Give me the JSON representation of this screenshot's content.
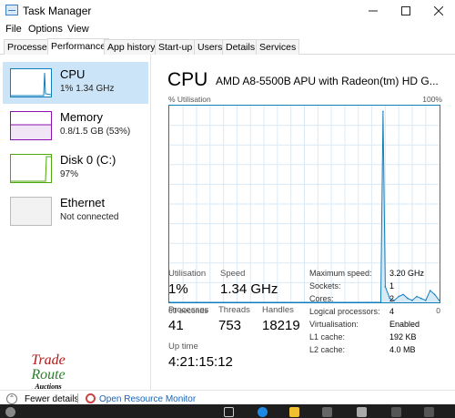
{
  "window": {
    "title": "Task Manager"
  },
  "menu": [
    "File",
    "Options",
    "View"
  ],
  "tabs": [
    "Processes",
    "Performance",
    "App history",
    "Start-up",
    "Users",
    "Details",
    "Services"
  ],
  "sidebar": [
    {
      "name": "CPU",
      "sub": "1% 1.34 GHz",
      "color": "#117dbb"
    },
    {
      "name": "Memory",
      "sub": "0.8/1.5 GB (53%)",
      "color": "#8b12ae"
    },
    {
      "name": "Disk 0 (C:)",
      "sub": "97%",
      "color": "#4da60c"
    },
    {
      "name": "Ethernet",
      "sub": "Not connected",
      "color": "#bbbbbb"
    }
  ],
  "main": {
    "title": "CPU",
    "model": "AMD A8-5500B APU with Radeon(tm) HD G...",
    "graph_label": "% Utilisation",
    "graph_max": "100%",
    "axis_left": "60 seconds",
    "axis_right": "0"
  },
  "stats": {
    "utilisation": {
      "label": "Utilisation",
      "value": "1%"
    },
    "speed": {
      "label": "Speed",
      "value": "1.34 GHz"
    },
    "processes": {
      "label": "Processes",
      "value": "41"
    },
    "threads": {
      "label": "Threads",
      "value": "753"
    },
    "handles": {
      "label": "Handles",
      "value": "18219"
    },
    "uptime": {
      "label": "Up time",
      "value": "4:21:15:12"
    }
  },
  "specs": [
    {
      "label": "Maximum speed:",
      "value": "3.20 GHz"
    },
    {
      "label": "Sockets:",
      "value": "1"
    },
    {
      "label": "Cores:",
      "value": "2"
    },
    {
      "label": "Logical processors:",
      "value": "4"
    },
    {
      "label": "Virtualisation:",
      "value": "Enabled"
    },
    {
      "label": "L1 cache:",
      "value": "192 KB"
    },
    {
      "label": "L2 cache:",
      "value": "4.0 MB"
    }
  ],
  "footer": {
    "fewer": "Fewer details",
    "monitor": "Open Resource Monitor"
  },
  "watermark": [
    "Trade",
    "Route",
    "Auctions"
  ],
  "chart_data": {
    "type": "area",
    "xlabel": "60 seconds",
    "ylabel": "% Utilisation",
    "xlim": [
      60,
      0
    ],
    "ylim": [
      0,
      100
    ],
    "x": [
      60,
      16,
      14,
      13,
      12.5,
      12,
      11,
      10,
      9,
      8,
      7,
      6,
      5,
      4,
      3,
      2,
      1,
      0
    ],
    "values": [
      0,
      0,
      0,
      0,
      97,
      8,
      2,
      1,
      3,
      4,
      2,
      1,
      3,
      2,
      1,
      6,
      4,
      1
    ]
  }
}
